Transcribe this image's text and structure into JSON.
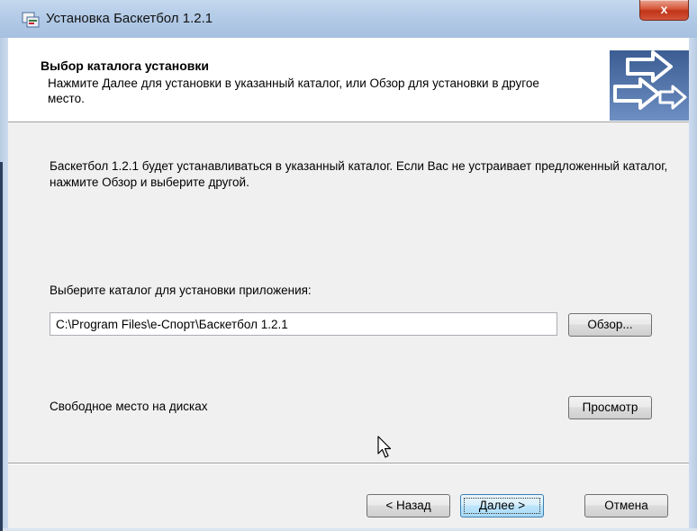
{
  "window": {
    "title": "Установка Баскетбол 1.2.1",
    "close_label": "x"
  },
  "header": {
    "title": "Выбор каталога установки",
    "subtitle": "Нажмите Далее для установки в указанный каталог, или Обзор для установки в другое место."
  },
  "body": {
    "intro": "Баскетбол 1.2.1 будет устанавливаться в указанный каталог. Если Вас не устраивает предложенный каталог, нажмите Обзор и выберите другой.",
    "dir_label": "Выберите каталог для установки приложения:",
    "dir_value": "C:\\Program Files\\e-Спорт\\Баскетбол 1.2.1",
    "browse_label": "Обзор...",
    "space_label": "Свободное место на дисках",
    "view_label": "Просмотр"
  },
  "footer": {
    "back_label": "< Назад",
    "next_label": "Далее >",
    "cancel_label": "Отмена"
  },
  "colors": {
    "titlebar": "#b3cbe7",
    "client_bg": "#f0f0f0",
    "close_red": "#c03518",
    "default_button_border": "#3c7fb1"
  },
  "icons": {
    "title_icon": "installer-icon",
    "header_logo": "arrows-logo-icon",
    "cursor": "mouse-pointer-icon"
  }
}
